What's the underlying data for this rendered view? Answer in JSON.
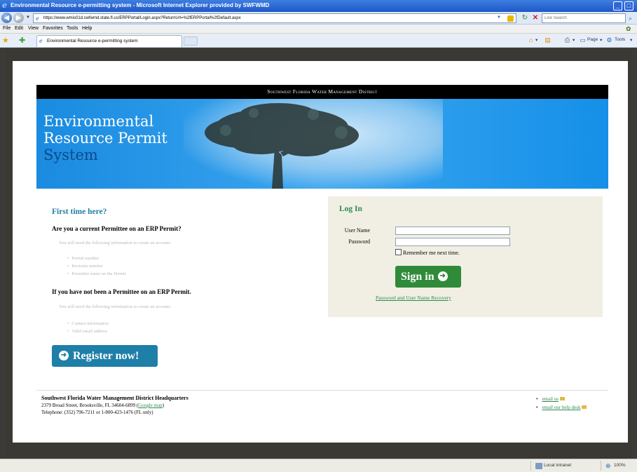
{
  "window": {
    "title": "Environmental Resource e-permitting system - Microsoft Internet Explorer provided by SWFWMD"
  },
  "address_bar": {
    "url": "https://www.wmis01d.swfwmd.state.fl.us/ERPPortal/Login.aspx?ReturnUrl=%2fERPPortal%2fDefault.aspx",
    "search_placeholder": "Live Search"
  },
  "menu": [
    "File",
    "Edit",
    "View",
    "Favorites",
    "Tools",
    "Help"
  ],
  "tabs": {
    "active_label": "Environmental Resource e-permitting system"
  },
  "command_bar": {
    "page_label": "Page",
    "tools_label": "Tools"
  },
  "page": {
    "agency_banner": "Southwest Florida Water Management District",
    "hero_title_line1": "Environmental",
    "hero_title_line2": "Resource Permit",
    "hero_title_line3": "System",
    "first_time": {
      "heading": "First time here?",
      "current_question": "Are you a current Permittee on an ERP Permit?",
      "current_hint": "You will need the following information to create an account:",
      "current_items": [
        "Permit number",
        "Revision number",
        "Permittee name on the Permit"
      ],
      "not_question": "If you have not been a Permittee on an ERP Permit.",
      "not_hint": "You will need the following information to create an account:",
      "not_items": [
        "Contact information",
        "Valid email address"
      ],
      "register_label": "Register now!"
    },
    "login": {
      "heading": "Log In",
      "username_label": "User Name",
      "password_label": "Password",
      "username_value": "",
      "password_value": "",
      "remember_label": "Remember me next time.",
      "signin_label": "Sign in",
      "recovery_link": "Password and User Name Recovery"
    },
    "footer": {
      "hq_title": "Southwest Florida Water Management District Headquarters",
      "address": "2379 Broad Street, Brooksville, FL 34604-6899 (",
      "map_link": "Google map",
      "address_end": ")",
      "telephone": "Telephone: (352) 796-7211 or 1-800-423-1476 (FL only)",
      "contact_links": [
        "email us",
        "email our help desk"
      ]
    }
  },
  "status_bar": {
    "zone": "Local intranet",
    "zoom": "100%"
  },
  "colors": {
    "title_bar": "#1f57c9",
    "hero_blue": "#1a8be0",
    "heading_teal": "#1f7ea3",
    "login_green": "#2f8b50",
    "register_button": "#1e7fa8",
    "signin_button": "#2f8b3a"
  }
}
